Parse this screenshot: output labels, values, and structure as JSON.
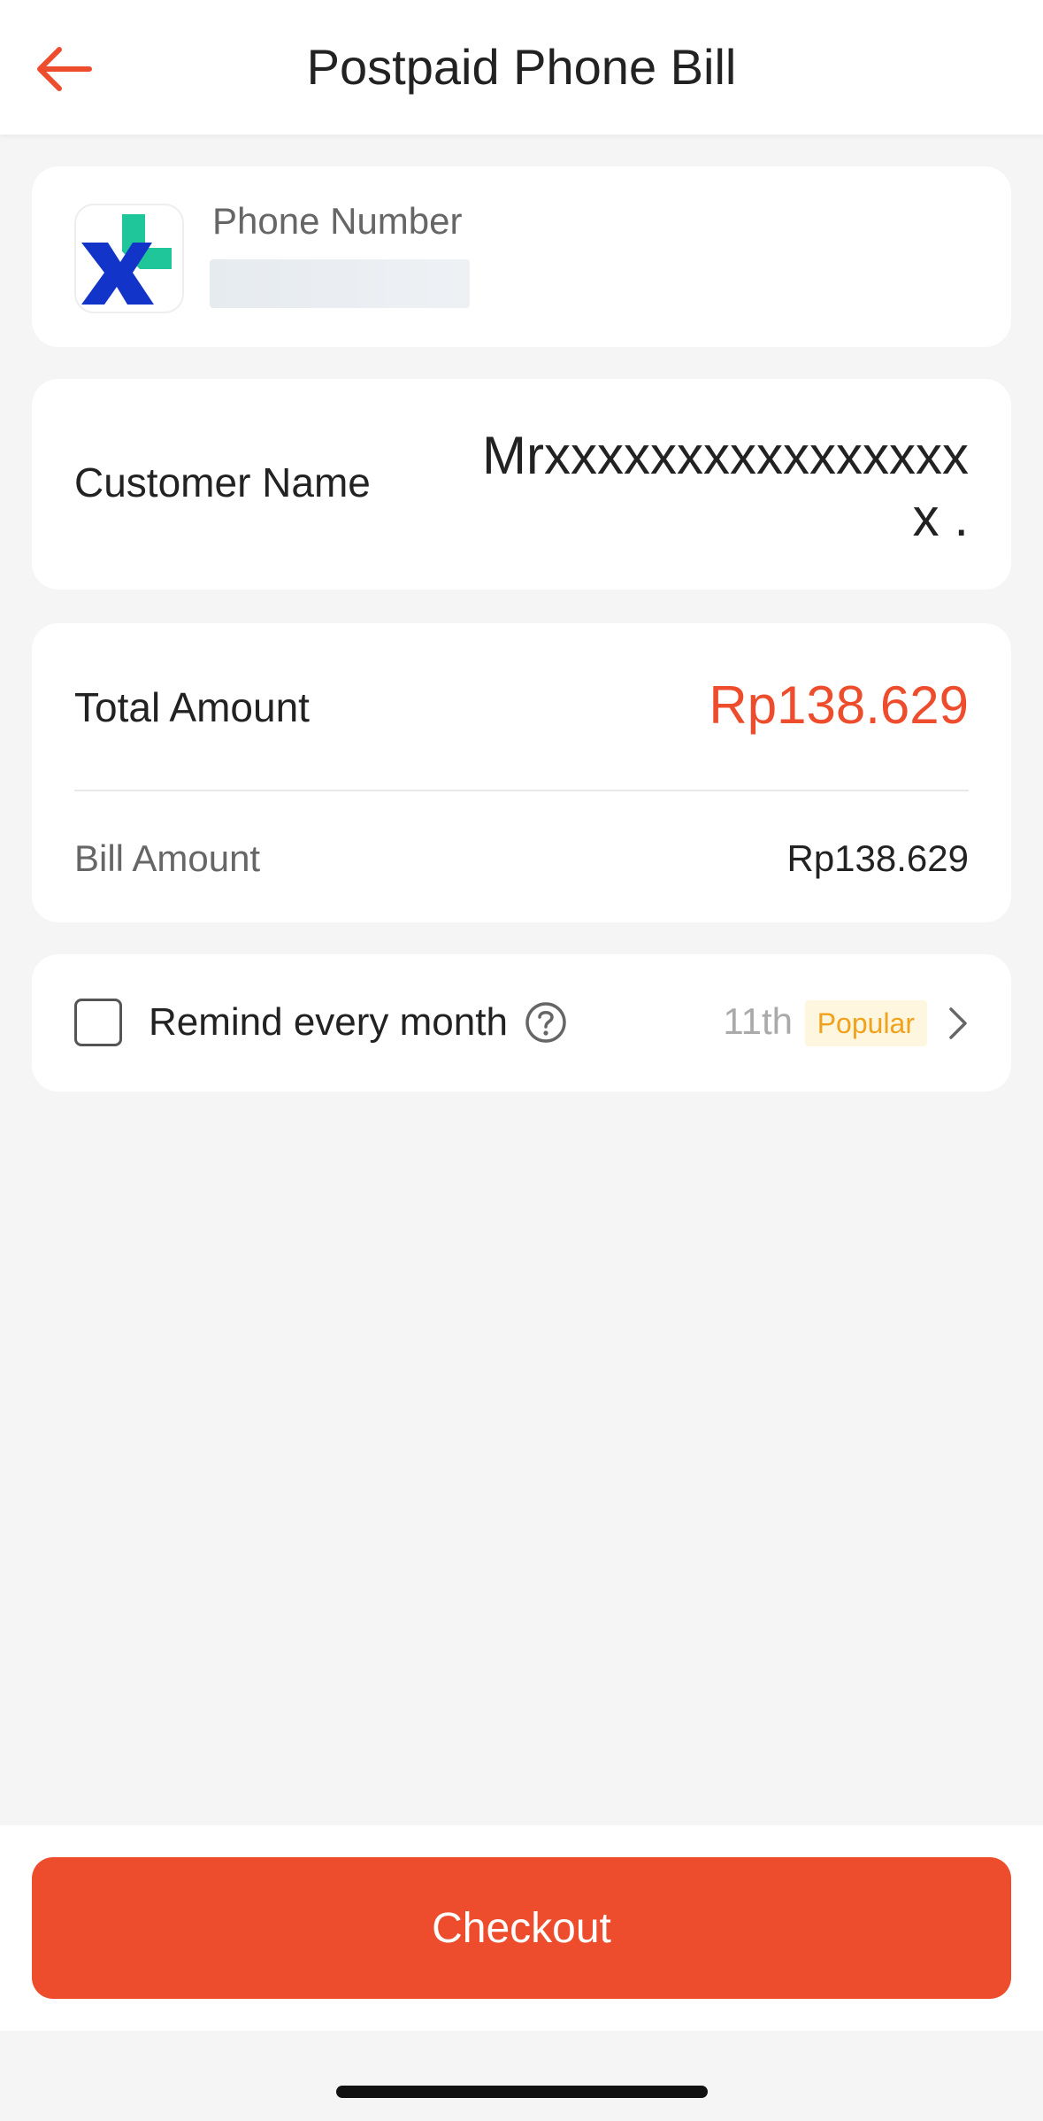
{
  "header": {
    "title": "Postpaid Phone Bill",
    "back_icon": "arrow-left-icon"
  },
  "phone_card": {
    "label": "Phone Number",
    "operator_logo": "xl-logo",
    "value_redacted": true
  },
  "customer_card": {
    "label": "Customer Name",
    "value": "Mrxxxxxxxxxxxxxxxxx ."
  },
  "amount_card": {
    "total_label": "Total Amount",
    "total_value": "Rp138.629",
    "bill_label": "Bill Amount",
    "bill_value": "Rp138.629"
  },
  "remind_card": {
    "label": "Remind every month",
    "checked": false,
    "day": "11th",
    "badge": "Popular",
    "help_icon": "question-circle-icon",
    "chevron_icon": "chevron-right-icon"
  },
  "footer": {
    "checkout_label": "Checkout"
  },
  "colors": {
    "accent": "#ee4d2d",
    "badge_bg": "#fff6e0",
    "badge_text": "#f0a21a",
    "background": "#f5f5f5"
  }
}
